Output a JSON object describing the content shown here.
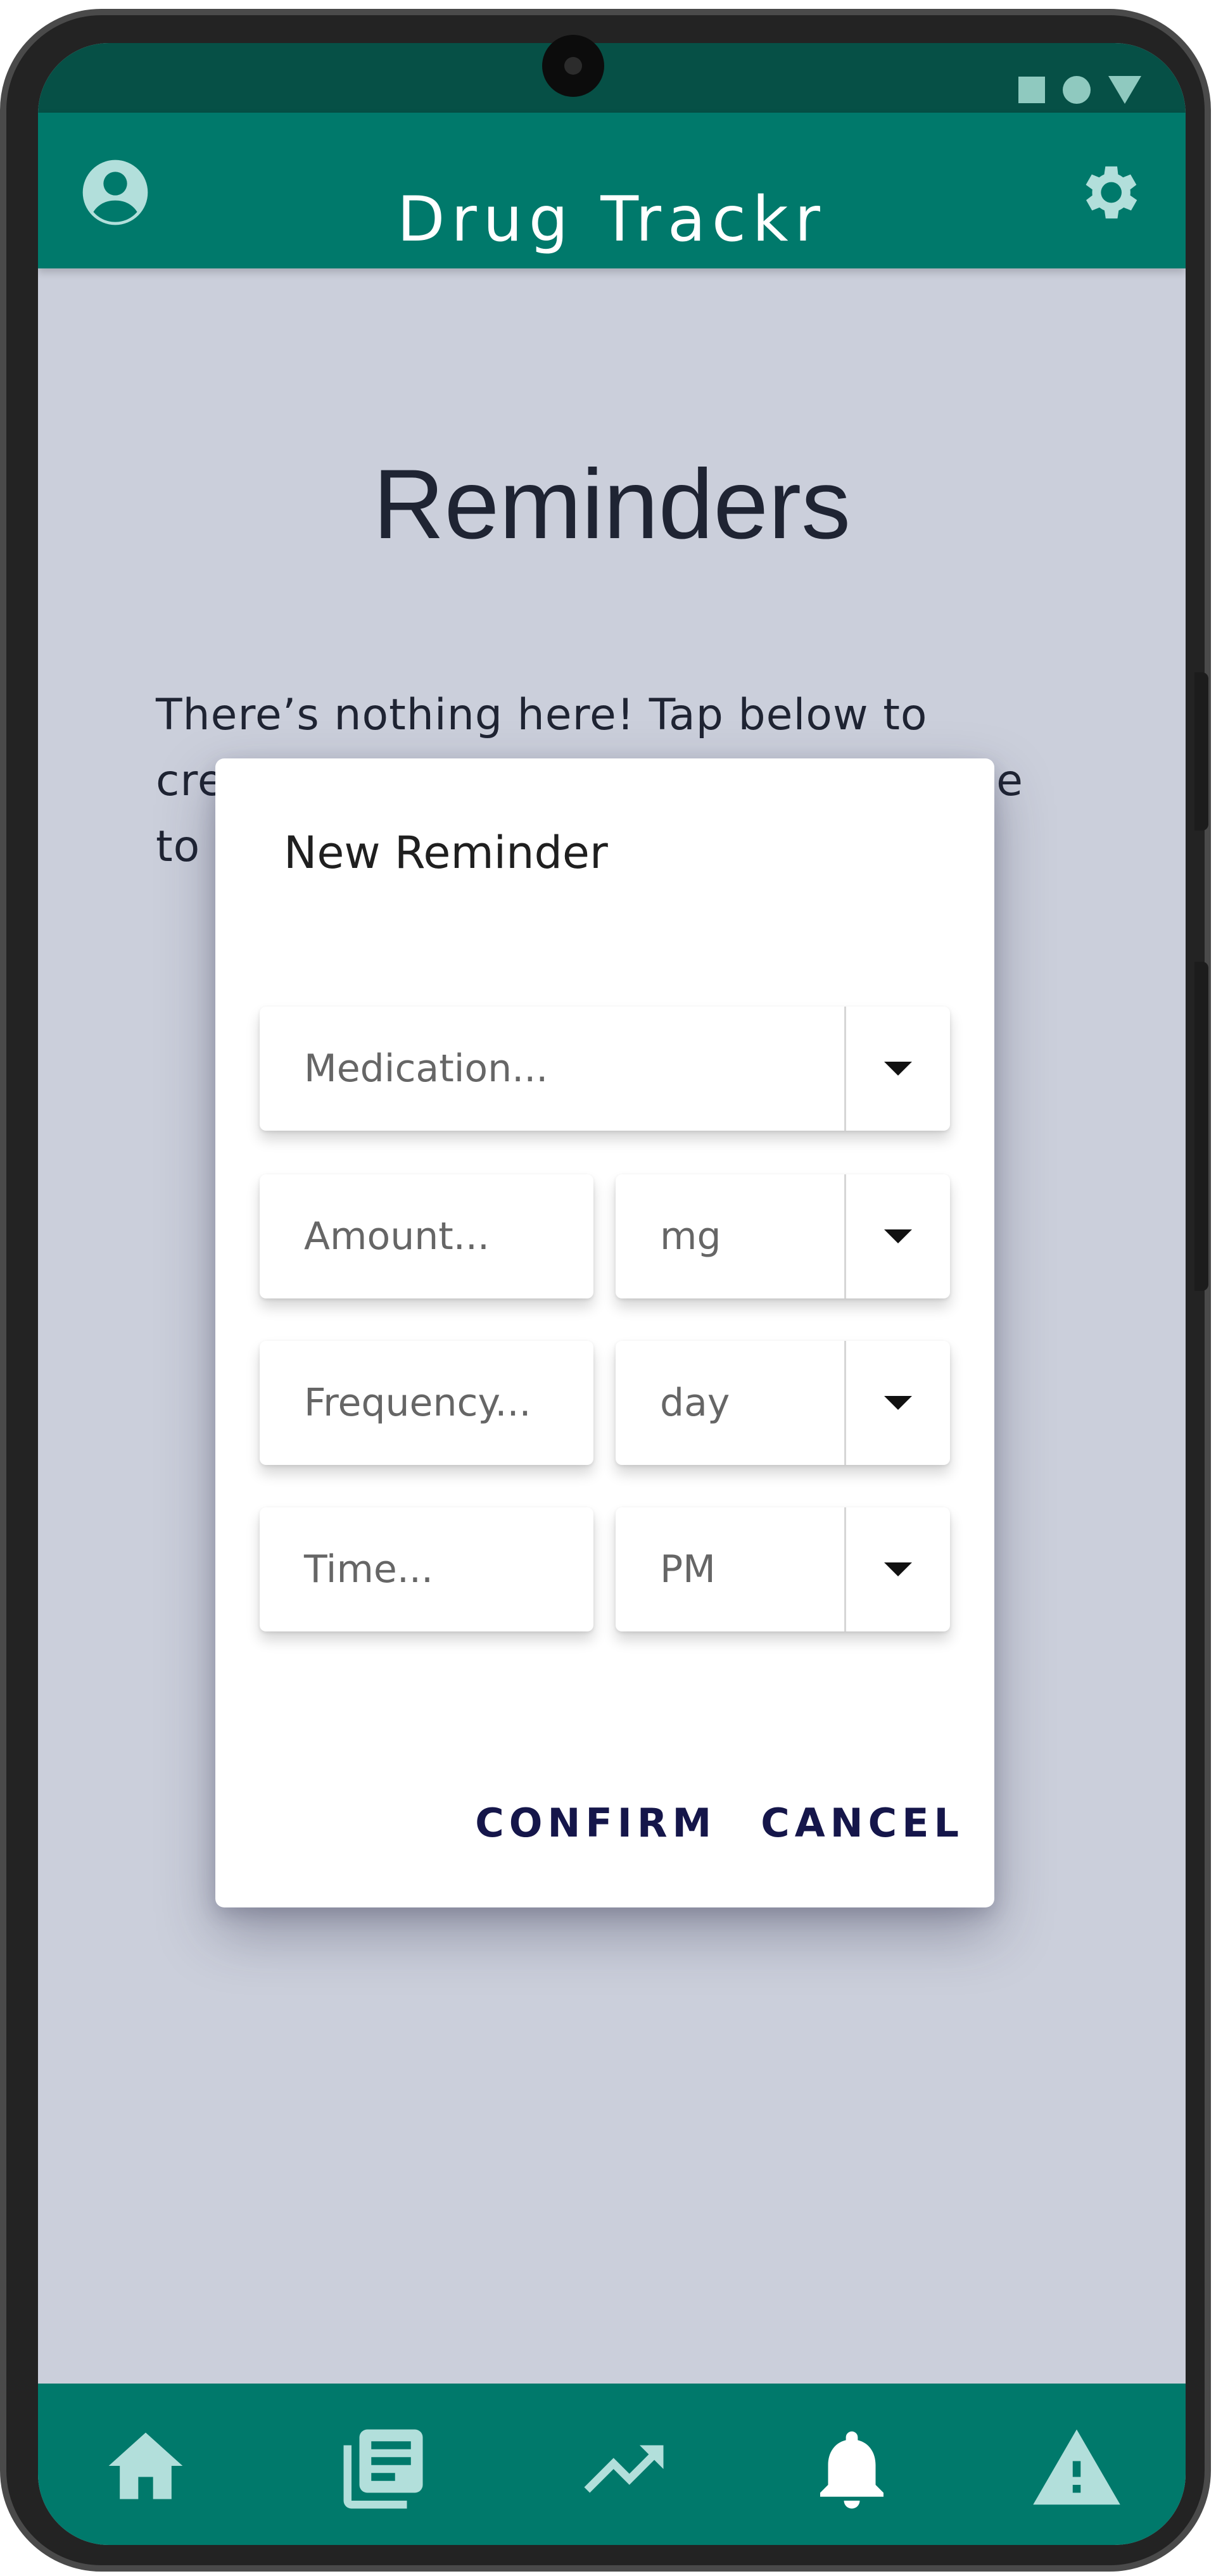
{
  "app": {
    "title": "Drug Trackr",
    "colors": {
      "primary": "#00796b",
      "status_bar": "#065046",
      "background": "#cbcfdb",
      "icon_tint": "#b2dfdb",
      "action_text": "#15164a"
    }
  },
  "header": {
    "left_icon": "account-circle-icon",
    "right_icon": "gear-icon"
  },
  "page": {
    "heading": "Reminders",
    "empty_message": "There’s nothing here! Tap below to create a new reminder. You can choose to edit or d"
  },
  "dialog": {
    "title": "New Reminder",
    "medication": {
      "placeholder": "Medication..."
    },
    "amount": {
      "placeholder": "Amount..."
    },
    "amount_unit": {
      "selected": "mg"
    },
    "frequency": {
      "placeholder": "Frequency..."
    },
    "frequency_period": {
      "selected": "day"
    },
    "time": {
      "placeholder": "Time..."
    },
    "time_period": {
      "selected": "PM"
    },
    "confirm_label": "CONFIRM",
    "cancel_label": "CANCEL"
  },
  "bottom_nav": {
    "items": [
      {
        "icon": "home-icon"
      },
      {
        "icon": "log-icon"
      },
      {
        "icon": "trending-icon"
      },
      {
        "icon": "bell-icon"
      },
      {
        "icon": "warning-icon"
      }
    ]
  }
}
